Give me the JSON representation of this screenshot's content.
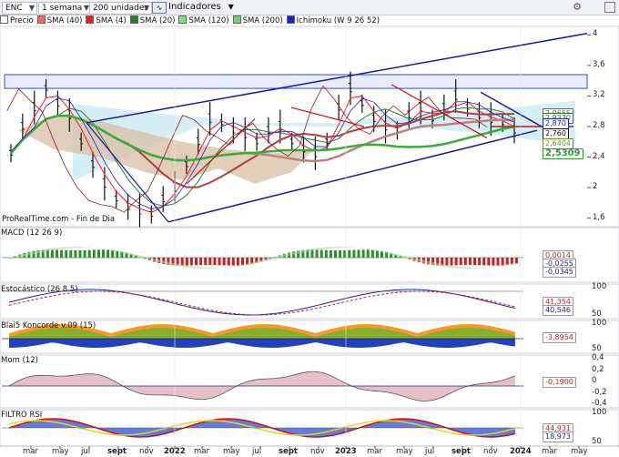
{
  "toolbar": {
    "ticker": "ENC",
    "period": "1 semana",
    "units": "200 unidades",
    "indicators_label": "Indicadores"
  },
  "legend": [
    {
      "label": "Precio",
      "color": "#ffffff"
    },
    {
      "label": "SMA (40)",
      "color": "#e07070"
    },
    {
      "label": "SMA (4)",
      "color": "#ff1a1a"
    },
    {
      "label": "SMA (20)",
      "color": "#2e7d2e"
    },
    {
      "label": "SMA (120)",
      "color": "#80e080"
    },
    {
      "label": "SMA (200)",
      "color": "#6fd06f"
    },
    {
      "label": "Ichimoku (W 9 26 52)",
      "color": "#2020c0"
    }
  ],
  "source": "ProRealTime.com - Fin de Dia",
  "price_axis": [
    "4",
    "3,6",
    "3,2",
    "2,8",
    "2,4",
    "2",
    "1,6"
  ],
  "price_labels": [
    {
      "text": "2,9655",
      "color": "#c04040"
    },
    {
      "text": "2,9330",
      "color": "#2e7d2e"
    },
    {
      "text": "2,870",
      "color": "#2020c0"
    },
    {
      "text": "2,760",
      "color": "#111111"
    },
    {
      "text": "2,6404",
      "color": "#6a8c3a"
    },
    {
      "text": "2,5309",
      "color": "#2e9d2e"
    }
  ],
  "panes": [
    {
      "title": "MACD (12 26 9)",
      "labels": [
        "0,0014",
        "-0,0255",
        "-0,0345"
      ]
    },
    {
      "title": "Estocástico (26 8 5)",
      "axis": [
        "100",
        "50"
      ],
      "labels": [
        "41,354",
        "40,546"
      ]
    },
    {
      "title": "Blai5 Koncorde v.09 (15)",
      "axis": [
        "100",
        "50"
      ],
      "labels": [
        "-3,8954"
      ]
    },
    {
      "title": "Mom (12)",
      "axis": [
        "0,4",
        "0,2",
        "0",
        "-0,2",
        "-0,4"
      ],
      "labels": [
        "-0,1900"
      ]
    },
    {
      "title": "FILTRO RSI",
      "axis": [
        "100",
        "50"
      ],
      "labels": [
        "44,931",
        "18,973"
      ]
    }
  ],
  "time_axis": [
    "mar",
    "may",
    "jul",
    "sept",
    "nov",
    "2022",
    "mar",
    "may",
    "jul",
    "sept",
    "nov",
    "2023",
    "mar",
    "may",
    "jul",
    "sept",
    "nov",
    "2024",
    "mar",
    "may"
  ],
  "chart_data": {
    "type": "line",
    "series": [
      {
        "name": "Precio",
        "values": [
          2.45,
          2.8,
          3.05,
          3.3,
          3.1,
          2.95,
          2.6,
          2.3,
          2.05,
          1.85,
          1.75,
          1.7,
          1.65,
          1.85,
          2.0,
          2.3,
          2.6,
          2.9,
          2.85,
          2.75,
          2.7,
          2.6,
          2.75,
          2.8,
          2.6,
          2.5,
          2.45,
          2.6,
          3.05,
          3.3,
          3.1,
          2.9,
          2.8,
          2.75,
          2.95,
          3.05,
          2.9,
          3.05,
          3.2,
          3.05,
          2.95,
          2.9,
          2.85,
          2.75
        ]
      }
    ],
    "x": [
      "2021-03",
      "2021-04",
      "2021-05",
      "2021-06",
      "2021-07",
      "2021-08",
      "2021-09",
      "2021-10",
      "2021-11",
      "2021-12",
      "2022-01",
      "2022-02",
      "2022-03",
      "2022-04",
      "2022-05",
      "2022-06",
      "2022-07",
      "2022-08",
      "2022-09",
      "2022-10",
      "2022-11",
      "2022-12",
      "2023-01",
      "2023-02",
      "2023-03",
      "2023-04",
      "2023-05",
      "2023-06",
      "2023-07",
      "2023-08",
      "2023-09",
      "2023-10",
      "2023-11",
      "2023-12",
      "2024-01"
    ],
    "ylim": [
      1.5,
      4.1
    ]
  }
}
